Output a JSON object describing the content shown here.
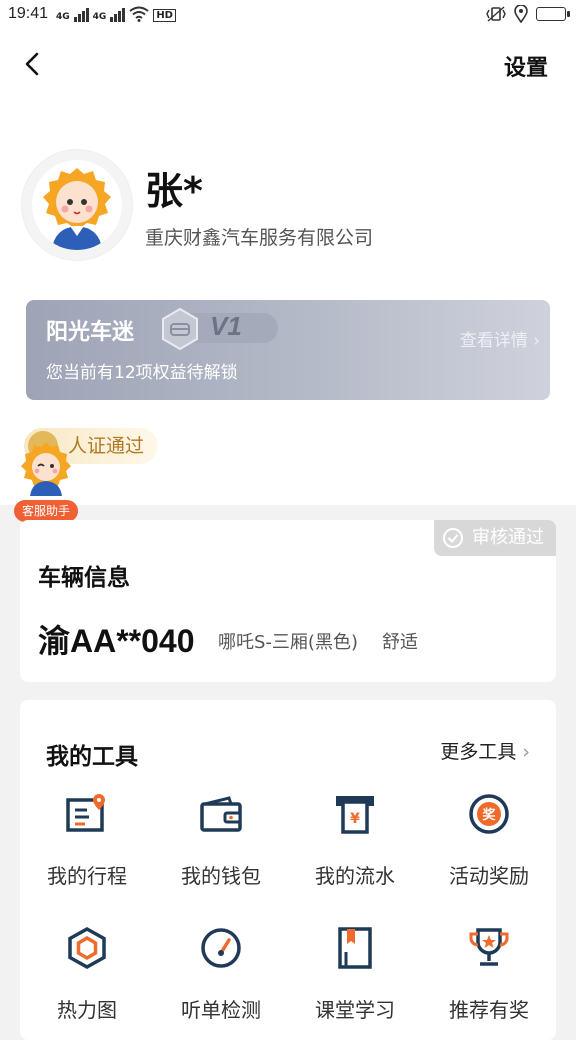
{
  "status_bar": {
    "time": "19:41",
    "net1": "4G",
    "net2": "4G",
    "hd": "HD"
  },
  "header": {
    "settings_label": "设置"
  },
  "profile": {
    "name": "张*",
    "company": "重庆财鑫汽车服务有限公司"
  },
  "membership": {
    "title": "阳光车迷",
    "level": "V1",
    "description": "您当前有12项权益待解锁",
    "detail_label": "查看详情 ›"
  },
  "certification": {
    "label": "人证通过"
  },
  "assistant": {
    "label": "客服助手"
  },
  "vehicle": {
    "heading": "车辆信息",
    "audit_status": "审核通过",
    "plate": "渝AA**040",
    "model": "哪吒S-三厢(黑色)",
    "service_type": "舒适"
  },
  "tools": {
    "heading": "我的工具",
    "more_label": "更多工具",
    "items": [
      {
        "label": "我的行程",
        "icon": "trip-icon"
      },
      {
        "label": "我的钱包",
        "icon": "wallet-icon"
      },
      {
        "label": "我的流水",
        "icon": "transactions-icon"
      },
      {
        "label": "活动奖励",
        "icon": "reward-icon"
      },
      {
        "label": "热力图",
        "icon": "heatmap-icon"
      },
      {
        "label": "听单检测",
        "icon": "gauge-icon"
      },
      {
        "label": "课堂学习",
        "icon": "book-icon"
      },
      {
        "label": "推荐有奖",
        "icon": "trophy-icon"
      }
    ]
  },
  "colors": {
    "icon_dark": "#1f3a57",
    "icon_accent": "#f06a2c",
    "assistant_badge": "#f06035",
    "cert_text": "#b07a24"
  }
}
